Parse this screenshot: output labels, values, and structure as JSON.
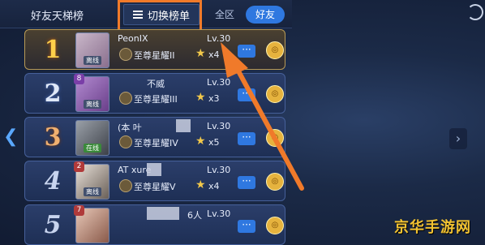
{
  "header": {
    "title": "好友天梯榜",
    "switch_label": "切换榜单",
    "segments": [
      "全区",
      "好友"
    ],
    "active_segment": "好友"
  },
  "rows": [
    {
      "rank": "1",
      "name": "PeonIX",
      "level": "Lv.30",
      "status": "离线",
      "tier": "至尊星耀II",
      "stars": "x4"
    },
    {
      "rank": "2",
      "name": "不威",
      "level": "Lv.30",
      "status": "离线",
      "tier": "至尊星耀III",
      "stars": "x3",
      "badge": "8"
    },
    {
      "rank": "3",
      "name": "(本 叶",
      "level": "Lv.30",
      "status": "在线",
      "tier": "至尊星耀IV",
      "stars": "x5"
    },
    {
      "rank": "4",
      "name": "AT xure",
      "level": "Lv.30",
      "status": "离线",
      "tier": "至尊星耀V",
      "stars": "x4",
      "badge": "2"
    },
    {
      "rank": "5",
      "name": "6人",
      "level": "Lv.30",
      "status": "",
      "tier": "",
      "stars": "",
      "badge": "7"
    }
  ],
  "watermark": "京华手游网",
  "colors": {
    "accent": "#2f78e0",
    "highlight": "#f07a2a",
    "watermark": "#f1c232"
  }
}
